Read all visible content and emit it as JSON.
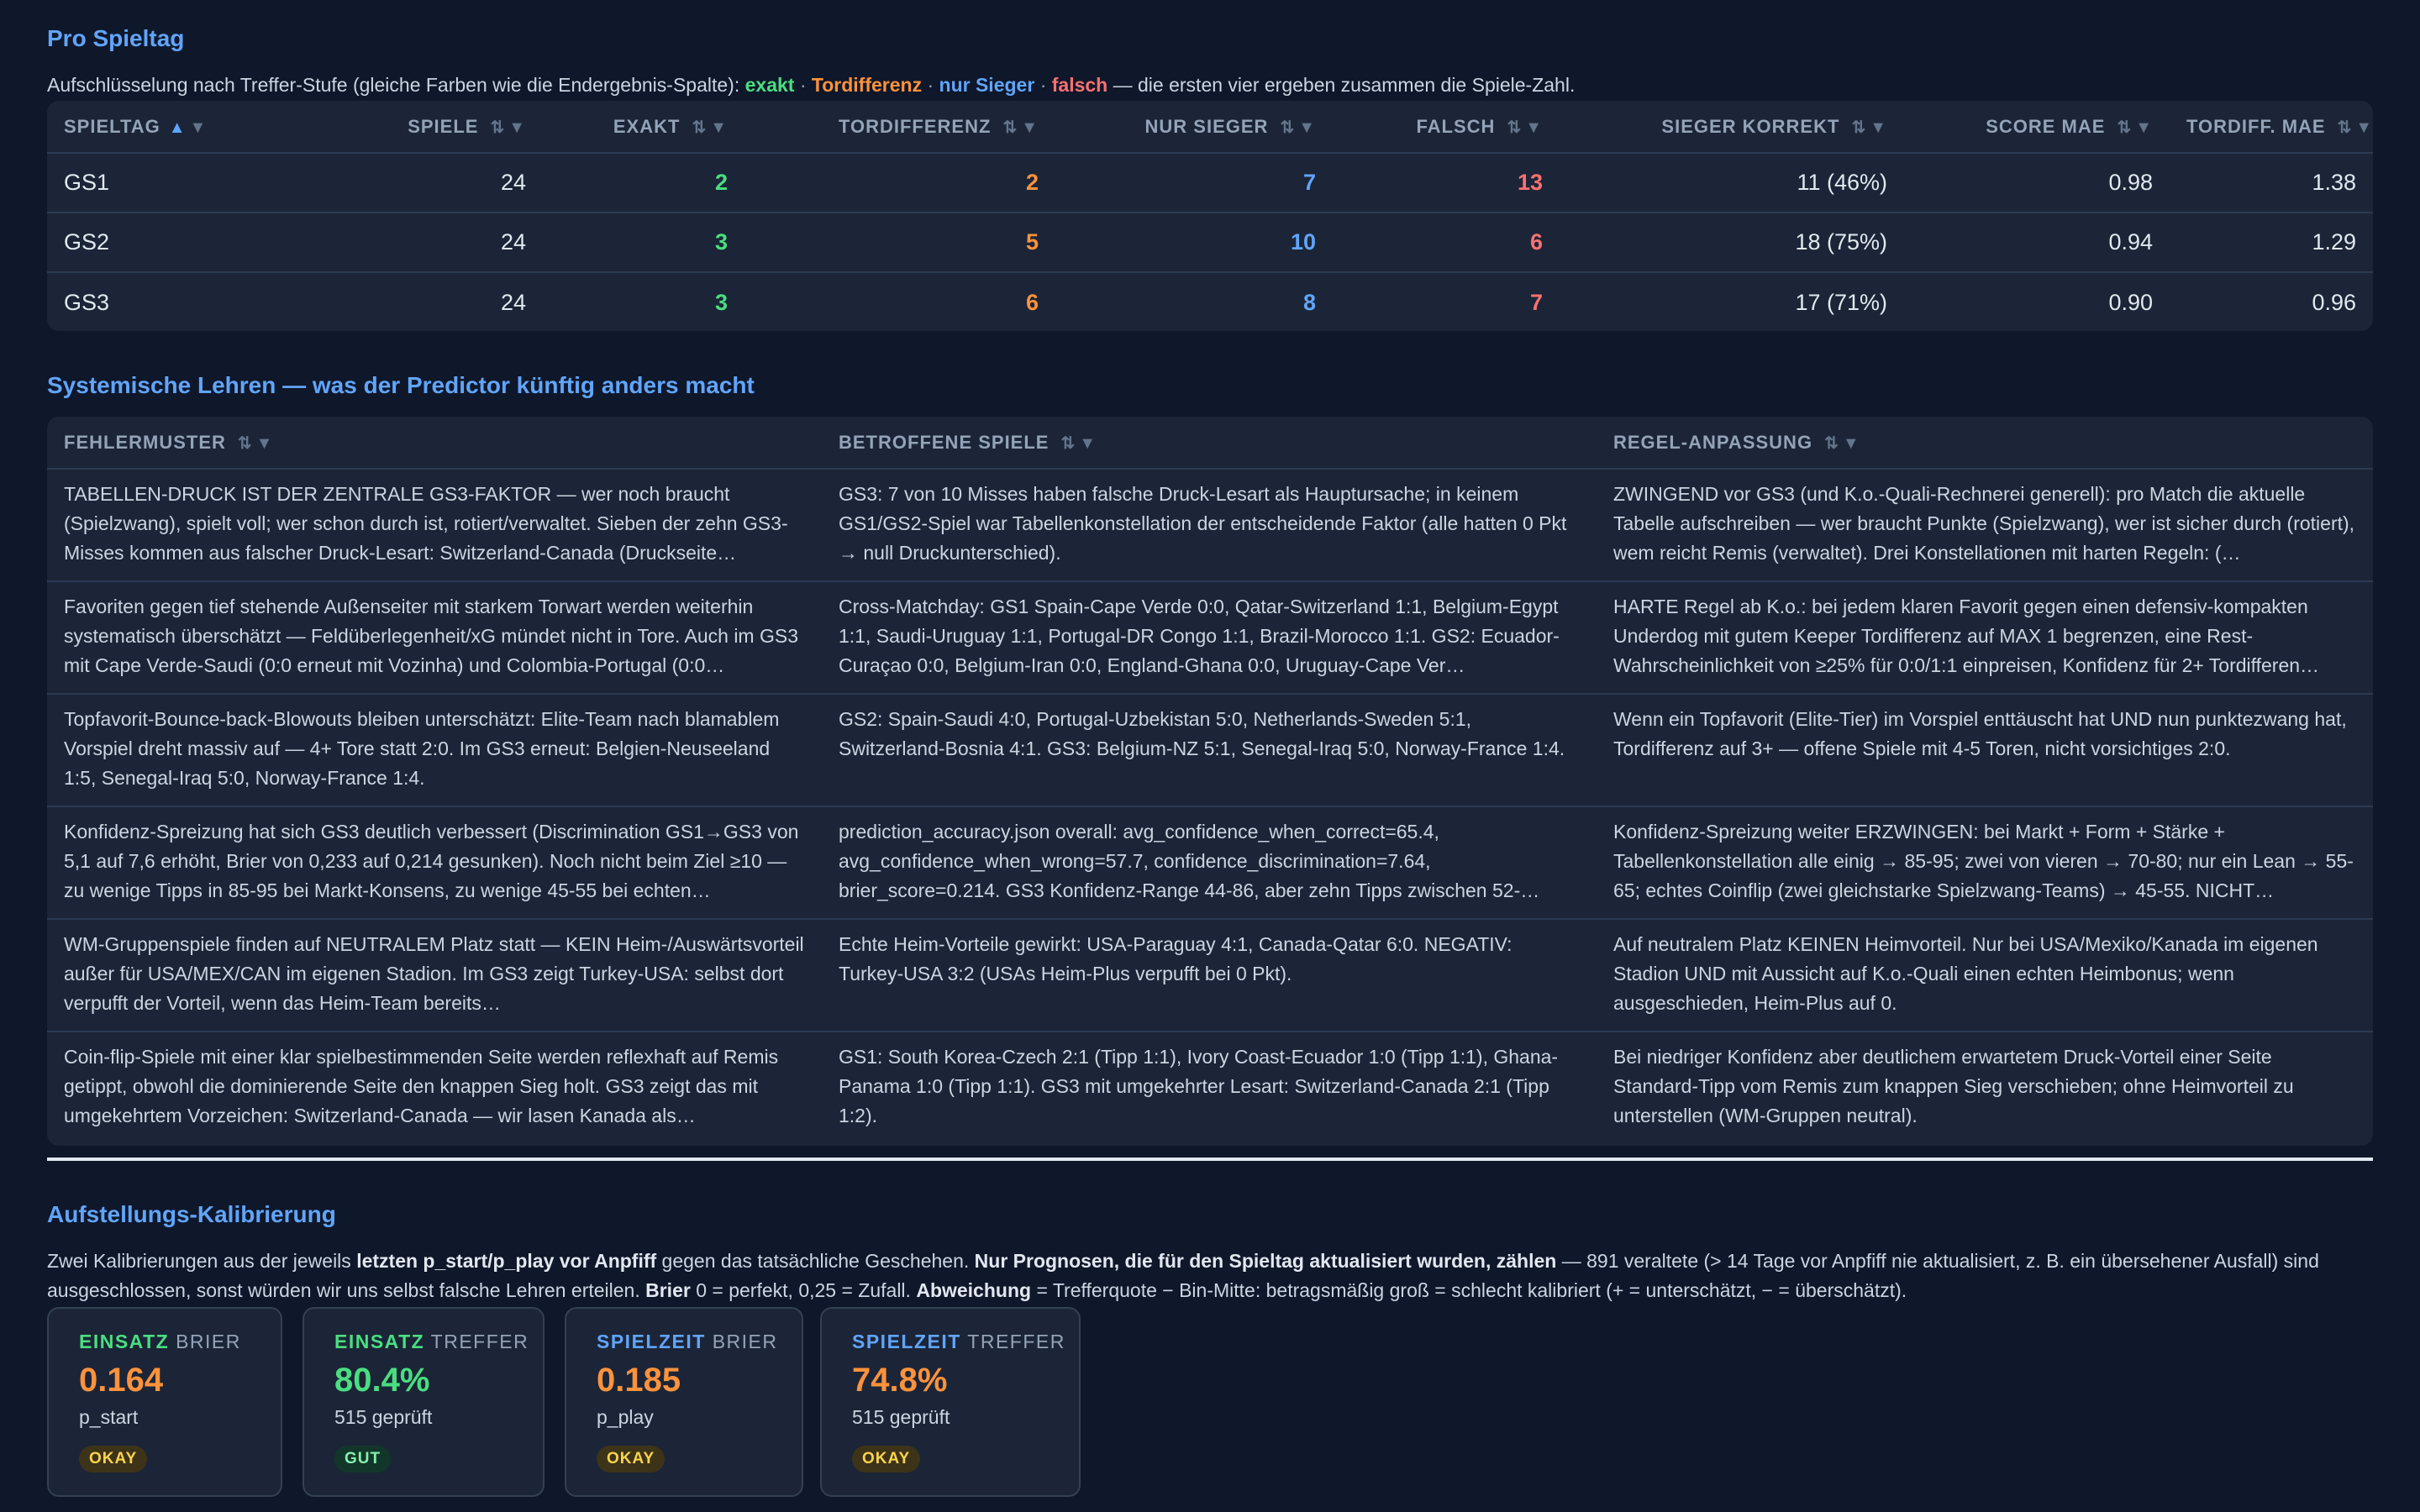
{
  "pro_spieltag": {
    "title": "Pro Spieltag",
    "subtitle_prefix": "Aufschlüsselung nach Treffer-Stufe (gleiche Farben wie die Endergebnis-Spalte):",
    "legend": {
      "exakt": "exakt",
      "tordifferenz": "Tordifferenz",
      "nur_sieger": "nur Sieger",
      "falsch": "falsch",
      "separator": "·"
    },
    "subtitle_suffix": "— die ersten vier ergeben zusammen die Spiele-Zahl.",
    "columns": [
      "Spieltag",
      "Spiele",
      "Exakt",
      "Tordifferenz",
      "Nur Sieger",
      "Falsch",
      "Sieger korrekt",
      "Score MAE",
      "Tordiff. MAE"
    ],
    "rows": [
      {
        "spieltag": "GS1",
        "spiele": "24",
        "exakt": "2",
        "tordifferenz": "2",
        "nur_sieger": "7",
        "falsch": "13",
        "sieger_korrekt": "11 (46%)",
        "score_mae": "0.98",
        "tordiff_mae": "1.38"
      },
      {
        "spieltag": "GS2",
        "spiele": "24",
        "exakt": "3",
        "tordifferenz": "5",
        "nur_sieger": "10",
        "falsch": "6",
        "sieger_korrekt": "18 (75%)",
        "score_mae": "0.94",
        "tordiff_mae": "1.29"
      },
      {
        "spieltag": "GS3",
        "spiele": "24",
        "exakt": "3",
        "tordifferenz": "6",
        "nur_sieger": "8",
        "falsch": "7",
        "sieger_korrekt": "17 (71%)",
        "score_mae": "0.90",
        "tordiff_mae": "0.96"
      }
    ]
  },
  "lehren": {
    "title": "Systemische Lehren — was der Predictor künftig anders macht",
    "columns": [
      "Fehlermuster",
      "Betroffene Spiele",
      "Regel-Anpassung"
    ],
    "rows": [
      {
        "fehlermuster": "TABELLEN-DRUCK IST DER ZENTRALE GS3-FAKTOR — wer noch braucht (Spielzwang), spielt voll; wer schon durch ist, rotiert/verwaltet. Sieben der zehn GS3-Misses kommen aus falscher Druck-Lesart: Switzerland-Canada (Druckseite…",
        "betroffene": "GS3: 7 von 10 Misses haben falsche Druck-Lesart als Hauptursache; in keinem GS1/GS2-Spiel war Tabellenkonstellation der entscheidende Faktor (alle hatten 0 Pkt → null Druckunterschied).",
        "regel": "ZWINGEND vor GS3 (und K.o.-Quali-Rechnerei generell): pro Match die aktuelle Tabelle aufschreiben — wer braucht Punkte (Spielzwang), wer ist sicher durch (rotiert), wem reicht Remis (verwaltet). Drei Konstellationen mit harten Regeln: (…"
      },
      {
        "fehlermuster": "Favoriten gegen tief stehende Außenseiter mit starkem Torwart werden weiterhin systematisch überschätzt — Feldüberlegenheit/xG mündet nicht in Tore. Auch im GS3 mit Cape Verde-Saudi (0:0 erneut mit Vozinha) und Colombia-Portugal (0:0…",
        "betroffene": "Cross-Matchday: GS1 Spain-Cape Verde 0:0, Qatar-Switzerland 1:1, Belgium-Egypt 1:1, Saudi-Uruguay 1:1, Portugal-DR Congo 1:1, Brazil-Morocco 1:1. GS2: Ecuador-Curaçao 0:0, Belgium-Iran 0:0, England-Ghana 0:0, Uruguay-Cape Ver…",
        "regel": "HARTE Regel ab K.o.: bei jedem klaren Favorit gegen einen defensiv-kompakten Underdog mit gutem Keeper Tordifferenz auf MAX 1 begrenzen, eine Rest-Wahrscheinlichkeit von ≥25% für 0:0/1:1 einpreisen, Konfidenz für 2+ Tordifferen…"
      },
      {
        "fehlermuster": "Topfavorit-Bounce-back-Blowouts bleiben unterschätzt: Elite-Team nach blamablem Vorspiel dreht massiv auf — 4+ Tore statt 2:0. Im GS3 erneut: Belgien-Neuseeland 1:5, Senegal-Iraq 5:0, Norway-France 1:4.",
        "betroffene": "GS2: Spain-Saudi 4:0, Portugal-Uzbekistan 5:0, Netherlands-Sweden 5:1, Switzerland-Bosnia 4:1. GS3: Belgium-NZ 5:1, Senegal-Iraq 5:0, Norway-France 1:4.",
        "regel": "Wenn ein Topfavorit (Elite-Tier) im Vorspiel enttäuscht hat UND nun punktezwang hat, Tordifferenz auf 3+ — offene Spiele mit 4-5 Toren, nicht vorsichtiges 2:0."
      },
      {
        "fehlermuster": "Konfidenz-Spreizung hat sich GS3 deutlich verbessert (Discrimination GS1→GS3 von 5,1 auf 7,6 erhöht, Brier von 0,233 auf 0,214 gesunken). Noch nicht beim Ziel ≥10 — zu wenige Tipps in 85-95 bei Markt-Konsens, zu wenige 45-55 bei echten…",
        "betroffene": "prediction_accuracy.json overall: avg_confidence_when_correct=65.4, avg_confidence_when_wrong=57.7, confidence_discrimination=7.64, brier_score=0.214. GS3 Konfidenz-Range 44-86, aber zehn Tipps zwischen 52-…",
        "regel": "Konfidenz-Spreizung weiter ERZWINGEN: bei Markt + Form + Stärke + Tabellenkonstellation alle einig → 85-95; zwei von vieren → 70-80; nur ein Lean → 55-65; echtes Coinflip (zwei gleichstarke Spielzwang-Teams) → 45-55. NICHT…"
      },
      {
        "fehlermuster": "WM-Gruppenspiele finden auf NEUTRALEM Platz statt — KEIN Heim-/Auswärtsvorteil außer für USA/MEX/CAN im eigenen Stadion. Im GS3 zeigt Turkey-USA: selbst dort verpufft der Vorteil, wenn das Heim-Team bereits…",
        "betroffene": "Echte Heim-Vorteile gewirkt: USA-Paraguay 4:1, Canada-Qatar 6:0. NEGATIV: Turkey-USA 3:2 (USAs Heim-Plus verpufft bei 0 Pkt).",
        "regel": "Auf neutralem Platz KEINEN Heimvorteil. Nur bei USA/Mexiko/Kanada im eigenen Stadion UND mit Aussicht auf K.o.-Quali einen echten Heimbonus; wenn ausgeschieden, Heim-Plus auf 0."
      },
      {
        "fehlermuster": "Coin-flip-Spiele mit einer klar spielbestimmenden Seite werden reflexhaft auf Remis getippt, obwohl die dominierende Seite den knappen Sieg holt. GS3 zeigt das mit umgekehrtem Vorzeichen: Switzerland-Canada — wir lasen Kanada als…",
        "betroffene": "GS1: South Korea-Czech 2:1 (Tipp 1:1), Ivory Coast-Ecuador 1:0 (Tipp 1:1), Ghana-Panama 1:0 (Tipp 1:1). GS3 mit umgekehrter Lesart: Switzerland-Canada 2:1 (Tipp 1:2).",
        "regel": "Bei niedriger Konfidenz aber deutlichem erwartetem Druck-Vorteil einer Seite Standard-Tipp vom Remis zum knappen Sieg verschieben; ohne Heimvorteil zu unterstellen (WM-Gruppen neutral)."
      }
    ]
  },
  "aufstellung": {
    "title": "Aufstellungs-Kalibrierung",
    "text": {
      "p1": "Zwei Kalibrierungen aus der jeweils ",
      "b1": "letzten p_start/p_play vor Anpfiff",
      "p2": " gegen das tatsächliche Geschehen. ",
      "b2": "Nur Prognosen, die für den Spieltag aktualisiert wurden, zählen",
      "p3": " — 891 veraltete (> 14 Tage vor Anpfiff nie aktualisiert, z. B. ein übersehener Ausfall) sind ausgeschlossen, sonst würden wir uns selbst falsche Lehren erteilen. ",
      "b3": "Brier",
      "p4": " 0 = perfekt, 0,25 = Zufall. ",
      "b4": "Abweichung",
      "p5": " = Trefferquote − Bin-Mitte: betragsmäßig groß = schlecht kalibriert (+ = unterschätzt, − = überschätzt)."
    },
    "cards": [
      {
        "key": "Einsatz",
        "label": "Brier",
        "value": "0.164",
        "sub": "p_start",
        "badge": "OKAY"
      },
      {
        "key": "Einsatz",
        "label": "Treffer",
        "value": "80.4%",
        "sub": "515 geprüft",
        "badge": "GUT"
      },
      {
        "key": "Spielzeit",
        "label": "Brier",
        "value": "0.185",
        "sub": "p_play",
        "badge": "OKAY"
      },
      {
        "key": "Spielzeit",
        "label": "Treffer",
        "value": "74.8%",
        "sub": "515 geprüft",
        "badge": "OKAY"
      }
    ]
  },
  "colors": {
    "background": "#0f172a",
    "panel": "#1b2537",
    "accent": "#60a5fa",
    "exakt": "#4ade80",
    "tordifferenz": "#fb923c",
    "nur_sieger": "#60a5fa",
    "falsch": "#f87171"
  }
}
